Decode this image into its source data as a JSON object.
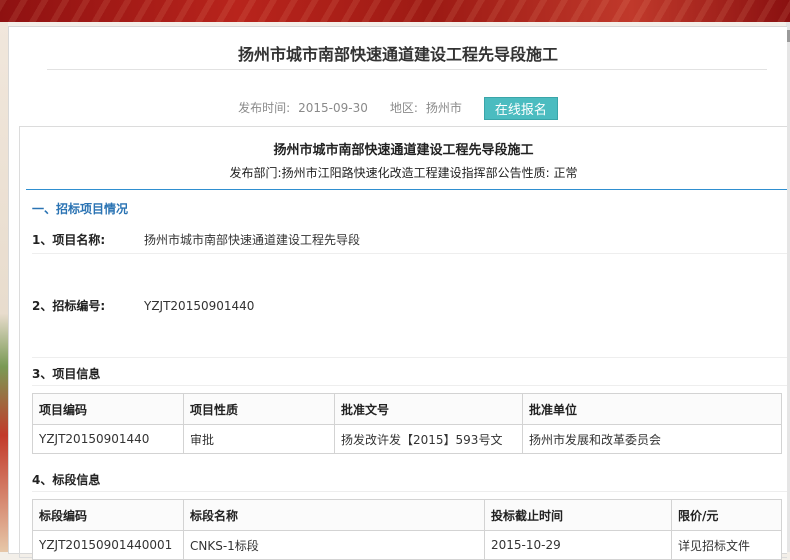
{
  "page": {
    "title": "扬州市城市南部快速通道建设工程先导段施工",
    "publish_label": "发布时间:",
    "publish_date": "2015-09-30",
    "region_label": "地区:",
    "region_value": "扬州市",
    "signup_button": "在线报名"
  },
  "doc": {
    "title": "扬州市城市南部快速通道建设工程先导段施工",
    "subtitle": "发布部门:扬州市江阳路快速化改造工程建设指挥部公告性质: 正常",
    "section1": "一、招标项目情况",
    "field1_label": "1、项目名称:",
    "field1_value": "扬州市城市南部快速通道建设工程先导段",
    "field2_label": "2、招标编号:",
    "field2_value": "YZJT20150901440",
    "project_info_title": "3、项目信息",
    "project_table": {
      "headers": [
        "项目编码",
        "项目性质",
        "批准文号",
        "批准单位"
      ],
      "rows": [
        [
          "YZJT20150901440",
          "审批",
          "扬发改许发【2015】593号文",
          "扬州市发展和改革委员会"
        ]
      ]
    },
    "section_info_title": "4、标段信息",
    "section_table": {
      "headers": [
        "标段编码",
        "标段名称",
        "投标截止时间",
        "限价/元"
      ],
      "rows": [
        [
          "YZJT20150901440001",
          "CNKS-1标段",
          "2015-10-29",
          "详见招标文件"
        ]
      ]
    }
  },
  "colors": {
    "banner": "#b8241c",
    "button": "#4bbcc0",
    "section_heading": "#2a73b3",
    "rule": "#2f8fd0"
  }
}
